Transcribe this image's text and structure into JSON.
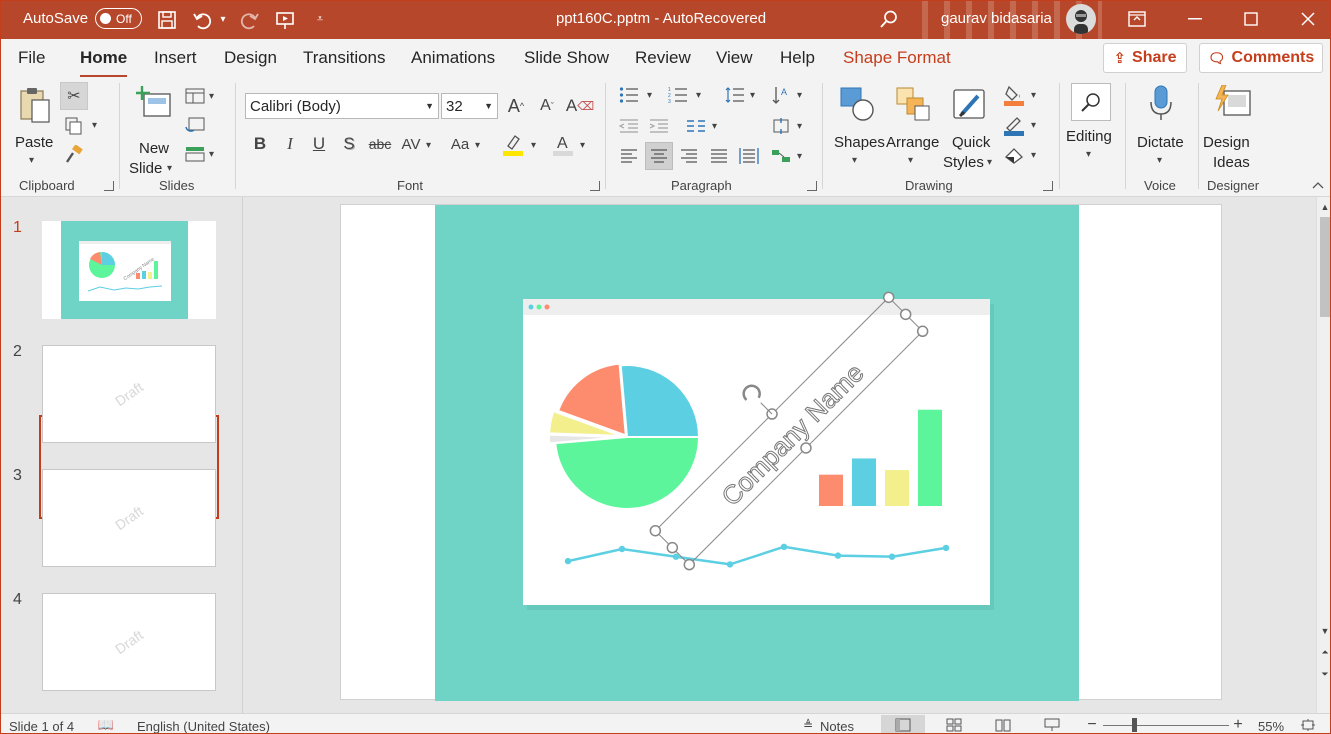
{
  "titlebar": {
    "autosave_label": "AutoSave",
    "autosave_state": "Off",
    "doc_title": "ppt160C.pptm  -  AutoRecovered",
    "user_name": "gaurav bidasaria",
    "accent": "#b7472a"
  },
  "menu": {
    "tabs": [
      "File",
      "Home",
      "Insert",
      "Design",
      "Transitions",
      "Animations",
      "Slide Show",
      "Review",
      "View",
      "Help",
      "Shape Format"
    ],
    "share": "Share",
    "comments": "Comments"
  },
  "ribbon": {
    "clipboard": {
      "paste": "Paste",
      "group": "Clipboard"
    },
    "slides": {
      "new_slide_1": "New",
      "new_slide_2": "Slide",
      "group": "Slides"
    },
    "font": {
      "font_name": "Calibri (Body)",
      "font_size": "32",
      "group": "Font"
    },
    "paragraph": {
      "group": "Paragraph"
    },
    "drawing": {
      "shapes": "Shapes",
      "arrange": "Arrange",
      "quick_styles_1": "Quick",
      "quick_styles_2": "Styles",
      "group": "Drawing"
    },
    "editing": {
      "label": "Editing"
    },
    "voice": {
      "dictate": "Dictate",
      "group": "Voice"
    },
    "designer": {
      "ideas_1": "Design",
      "ideas_2": "Ideas",
      "group": "Designer"
    }
  },
  "slides_panel": {
    "slides": [
      {
        "num": "1"
      },
      {
        "num": "2",
        "watermark": "Draft"
      },
      {
        "num": "3",
        "watermark": "Draft"
      },
      {
        "num": "4",
        "watermark": "Draft"
      }
    ]
  },
  "slide": {
    "wordart": "Company Name",
    "pie_slices": [
      {
        "color": "#5ccfe3"
      },
      {
        "color": "#5cf59c"
      },
      {
        "color": "#e6e6e6"
      },
      {
        "color": "#f2ef8c"
      },
      {
        "color": "#fd8c6f"
      }
    ],
    "bar_colors": [
      "#fd8c6f",
      "#5ccfe3",
      "#f2ef8c",
      "#5cf59c"
    ],
    "bar_values": [
      0.27,
      0.41,
      0.31,
      0.83
    ],
    "line_points": [
      0.55,
      0.0,
      0.35,
      0.7,
      -0.1,
      0.3,
      0.35,
      -0.05
    ],
    "bg": "#6fd4c5"
  },
  "status": {
    "slide_info": "Slide 1 of 4",
    "language": "English (United States)",
    "notes": "Notes",
    "zoom": "55%"
  }
}
